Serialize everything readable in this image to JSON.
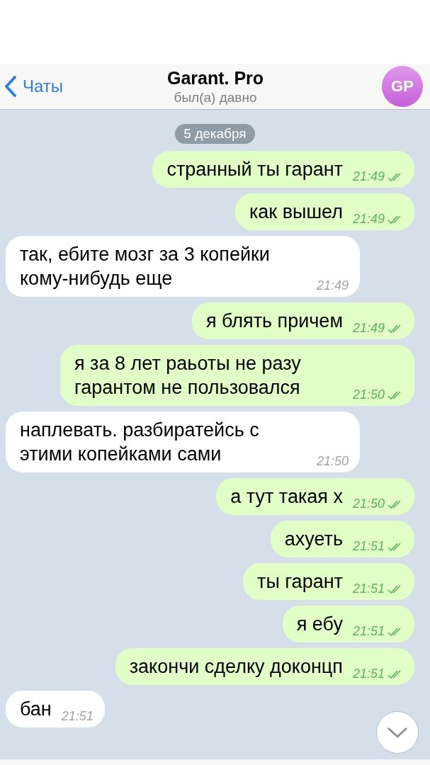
{
  "header": {
    "back_label": "Чаты",
    "title": "Garant. Pro",
    "status": "был(а) давно",
    "avatar_initials": "GP"
  },
  "date": "5 декабря",
  "messages": [
    {
      "kind": "out",
      "text": "странный ты гарант",
      "time": "21:49",
      "read": true
    },
    {
      "kind": "out",
      "text": "как вышел",
      "time": "21:49",
      "read": true
    },
    {
      "kind": "in",
      "text": "так, ебите мозг за 3 копейки кому-нибудь еще",
      "time": "21:49"
    },
    {
      "kind": "out",
      "text": "я блять причем",
      "time": "21:49",
      "read": true
    },
    {
      "kind": "out",
      "text": "я за 8 лет раьоты не разу гарантом не пользовался",
      "time": "21:50",
      "read": true
    },
    {
      "kind": "in",
      "text": "наплевать. разбиратейсь с этими копейками сами",
      "time": "21:50"
    },
    {
      "kind": "out",
      "text": "а тут такая х",
      "time": "21:50",
      "read": true
    },
    {
      "kind": "out",
      "text": "ахуеть",
      "time": "21:51",
      "read": true
    },
    {
      "kind": "out",
      "text": "ты гарант",
      "time": "21:51",
      "read": true
    },
    {
      "kind": "out",
      "text": "я ебу",
      "time": "21:51",
      "read": true
    },
    {
      "kind": "out",
      "text": "закончи сделку доконцп",
      "time": "21:51",
      "read": true
    },
    {
      "kind": "in",
      "text": "бан",
      "time": "21:51"
    }
  ]
}
